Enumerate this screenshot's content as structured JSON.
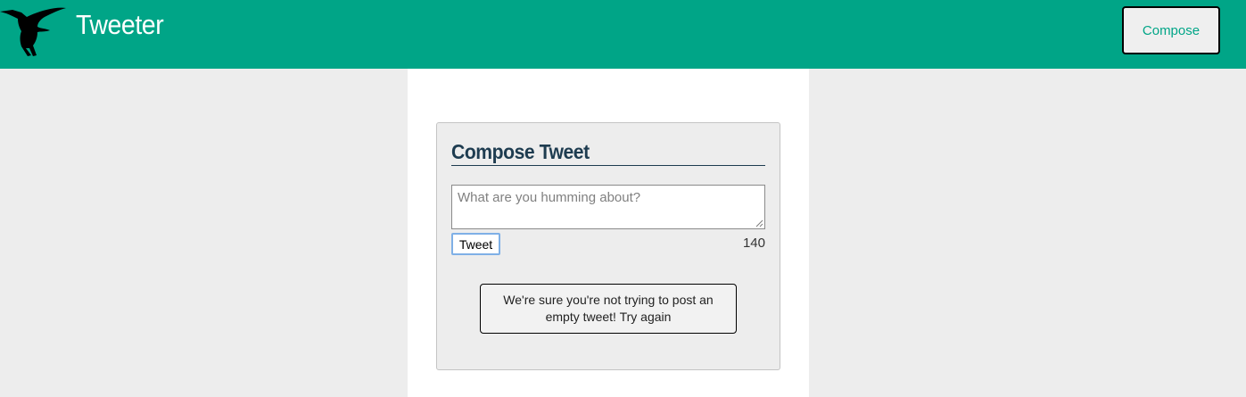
{
  "app": {
    "brand": "Tweeter",
    "compose_label": "Compose"
  },
  "composer": {
    "title": "Compose Tweet",
    "placeholder": "What are you humming about?",
    "value": "",
    "submit_label": "Tweet",
    "char_counter": "140"
  },
  "error": {
    "message": "We're sure you're not trying to post an empty tweet! Try again"
  },
  "icons": {
    "logo": "hummingbird-logo-icon",
    "resize": "resize-grip-icon"
  },
  "colors": {
    "nav_bg": "#00a587",
    "title": "#1e3c50",
    "page_bg": "#ededed"
  }
}
